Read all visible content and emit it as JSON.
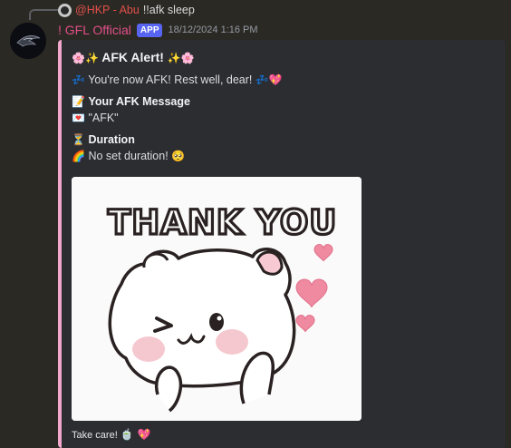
{
  "reply": {
    "username": "@HKP - Abu",
    "text": "!!afk sleep"
  },
  "message": {
    "username": "! GFL Official",
    "badge": "APP",
    "timestamp": "18/12/2024 1:16 PM"
  },
  "embed": {
    "title_prefix": "🌸✨",
    "title": "AFK Alert!",
    "title_suffix": "✨🌸",
    "status_prefix": "💤",
    "status_text": "You're now AFK! Rest well, dear!",
    "status_suffix": "💤💖",
    "message_icon": "📝",
    "message_label": "Your AFK Message",
    "message_value_icon": "💌",
    "message_value": "\"AFK\"",
    "duration_icon": "⏳",
    "duration_label": "Duration",
    "duration_value_icon": "🌈",
    "duration_value": "No set duration!",
    "duration_value_suffix": "🥺",
    "image_text": "THANK YOU",
    "footer_text": "Take care!",
    "footer_suffix": "🍵 💖"
  },
  "colors": {
    "background": "#2b2924",
    "embed_bg": "#2b2d31",
    "embed_accent": "#f2a8cc",
    "username": "#e0508a",
    "reply_username": "#e0504a",
    "badge": "#5865f2"
  }
}
